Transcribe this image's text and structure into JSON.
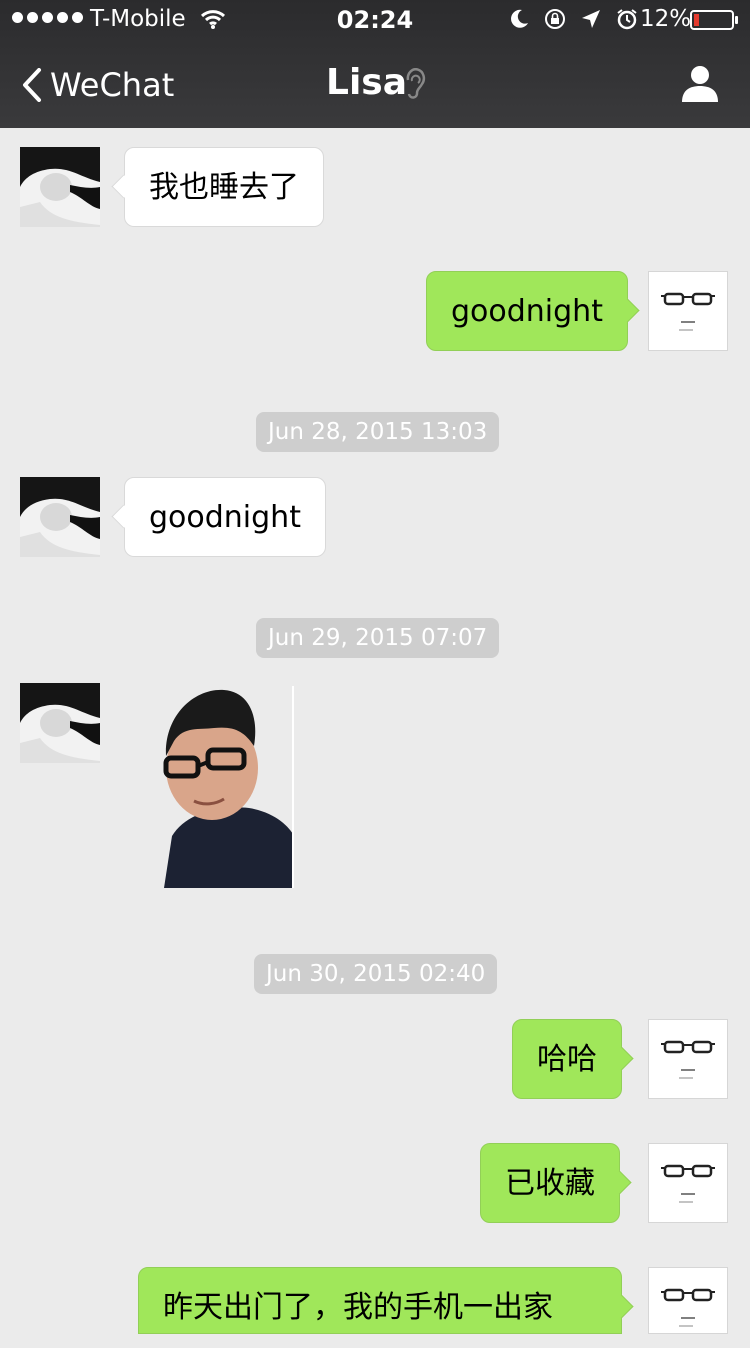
{
  "status_bar": {
    "carrier": "T-Mobile",
    "time": "02:24",
    "battery_percent": "12%",
    "battery_level": 0.12
  },
  "nav": {
    "back_label": "WeChat",
    "title": "Lisa"
  },
  "messages": [
    {
      "text": "我也睡去了"
    },
    {
      "text": "goodnight"
    },
    {
      "timestamp": "Jun 28, 2015 13:03"
    },
    {
      "text": "goodnight"
    },
    {
      "timestamp": "Jun 29, 2015 07:07"
    },
    {
      "timestamp": "Jun 30, 2015 02:40"
    },
    {
      "text": "哈哈"
    },
    {
      "text": "已收藏"
    },
    {
      "text": "昨天出门了，我的手机一出家"
    }
  ],
  "colors": {
    "sent_bubble": "#a0e75a",
    "received_bubble": "#ffffff",
    "chat_background": "#ebebeb",
    "header": "#333335"
  }
}
